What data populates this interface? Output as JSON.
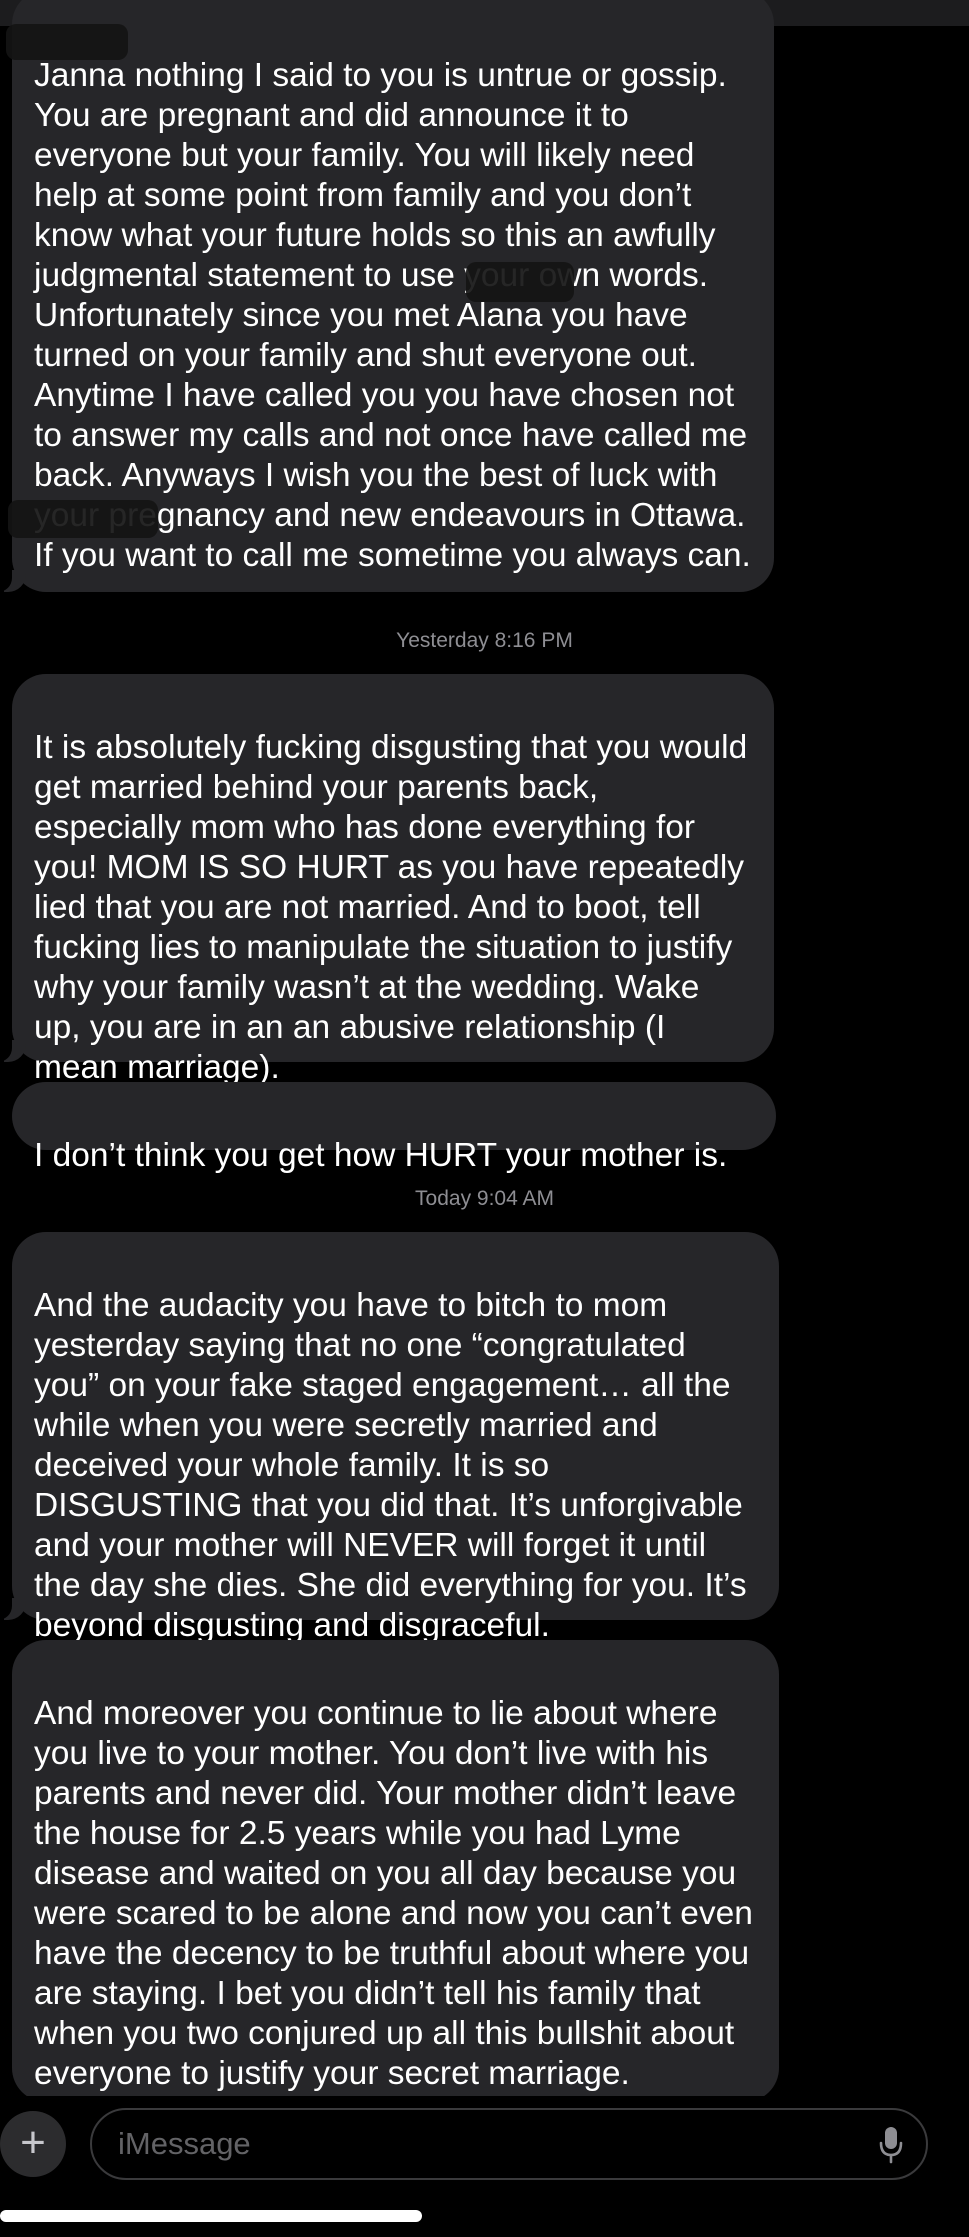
{
  "conversation": {
    "messages": [
      {
        "id": "m1",
        "text": "Janna nothing I said to you is untrue or gossip. You are pregnant and did announce it to everyone but your family. You will likely need help at some point from family and you don’t know what your future holds so this an awfully judgmental statement to use your own words. Unfortunately since you met Alana you have turned on your family and shut everyone out. Anytime I have called you you have chosen not to answer my calls and not once have called me back. Anyways I wish you the best of luck with your pregnancy and new endeavours in Ottawa. If you want to call me sometime you always can."
      },
      {
        "id": "m2",
        "text": "It is absolutely fucking disgusting that you would get married behind your parents back, especially mom who has done everything for you! MOM IS SO HURT as you have repeatedly lied that you are not married. And to boot, tell fucking lies to manipulate the situation to justify why your family wasn’t at the wedding. Wake up, you are in an an abusive relationship (I mean marriage)."
      },
      {
        "id": "m3",
        "text": "I don’t think you get how HURT your mother is."
      },
      {
        "id": "m4",
        "text": "And the audacity you have to bitch to mom yesterday saying that no one “congratulated you” on your fake staged engagement… all the while when you were secretly married and deceived your whole family. It is so DISGUSTING that you did that. It’s unforgivable and your mother will NEVER will forget it until the day she dies.  She did everything for you. It’s beyond disgusting and disgraceful."
      },
      {
        "id": "m5",
        "text": "And moreover you continue to lie about where you live to your mother. You don’t live with his parents and never did. Your mother didn’t leave the house for 2.5 years while you had Lyme disease and waited on you all day because you were scared to be alone and now you can’t even have the decency to be truthful about where you are staying. I bet you didn’t tell his family that when you two conjured up all this bullshit about everyone to justify your secret marriage."
      }
    ],
    "timestamps": [
      {
        "id": "t1",
        "text": "Yesterday 8:16 PM"
      },
      {
        "id": "t2",
        "text": "Today 9:04 AM"
      }
    ]
  },
  "composer": {
    "placeholder": "iMessage",
    "plus_icon": "plus-icon",
    "mic_icon": "microphone-icon"
  },
  "colors": {
    "background": "#000000",
    "bubble_incoming": "#262629",
    "timestamp_text": "#8e8e93",
    "placeholder_text": "#636366"
  }
}
